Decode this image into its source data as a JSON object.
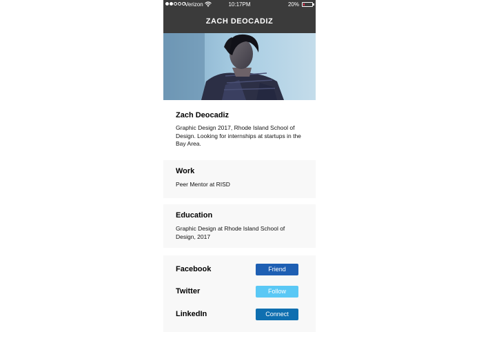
{
  "status_bar": {
    "carrier": "Verizon",
    "time": "10:17PM",
    "battery": "20%",
    "battery_level": 0.2,
    "signal_bars": 2,
    "signal_total": 5
  },
  "nav": {
    "title": "ZACH DEOCADIZ"
  },
  "profile": {
    "name": "Zach Deocadiz",
    "bio": "Graphic Design 2017, Rhode Island School of Design. Looking for internships at startups in the Bay Area."
  },
  "work": {
    "title": "Work",
    "text": "Peer Mentor at RISD"
  },
  "education": {
    "title": "Education",
    "text": "Graphic Design at Rhode Island School of Design, 2017"
  },
  "social": [
    {
      "label": "Facebook",
      "button": "Friend",
      "color": "#1e5fb3"
    },
    {
      "label": "Twitter",
      "button": "Follow",
      "color": "#5ac8f5"
    },
    {
      "label": "LinkedIn",
      "button": "Connect",
      "color": "#0f6fb0"
    }
  ],
  "colors": {
    "bar": "#3b3b3b",
    "battery_low": "#e0304d",
    "card_grey": "#f8f8f8"
  }
}
